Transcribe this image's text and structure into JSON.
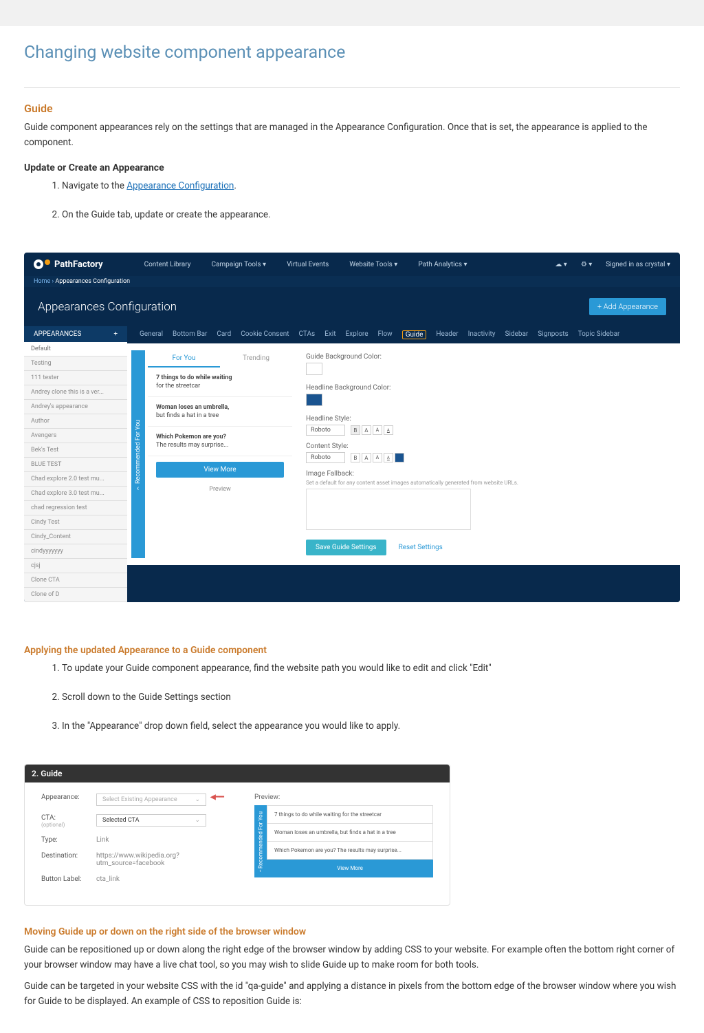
{
  "page_title": "Changing website component appearance",
  "guide_section": {
    "title": "Guide",
    "intro": "Guide component appearances rely on the settings that are managed in the Appearance Configuration. Once that is set, the appearance is applied to the component.",
    "update_heading": "Update or Create an Appearance",
    "step1_prefix": "Navigate to the ",
    "step1_link": "Appearance Configuration",
    "step1_suffix": ".",
    "step2": "On the Guide tab, update or create the appearance."
  },
  "shot1": {
    "logo": "PathFactory",
    "nav": [
      "Content Library",
      "Campaign Tools ▾",
      "Virtual Events",
      "Website Tools ▾",
      "Path Analytics ▾"
    ],
    "cloud_icon": "☁ ▾",
    "gear_icon": "⚙ ▾",
    "signed_in": "Signed in as crystal ▾",
    "breadcrumb_home": "Home",
    "breadcrumb_sep": " › ",
    "breadcrumb_page": "Appearances Configuration",
    "header": "Appearances Configuration",
    "btn_add": "+ Add Appearance",
    "sidebar_tab": "APPEARANCES",
    "sidebar_plus": "+",
    "sidebar_items": [
      "Default",
      "Testing",
      "111 tester",
      "Andrey clone this is a ver...",
      "Andrey's appearance",
      "Author",
      "Avengers",
      "Bek's Test",
      "BLUE TEST",
      "Chad explore 2.0 test mu...",
      "Chad explore 3.0 test mu...",
      "chad regression test",
      "Cindy Test",
      "Cindy_Content",
      "cindyyyyyyy",
      "cjsj",
      "Clone CTA",
      "Clone of D"
    ],
    "tabs": [
      "General",
      "Bottom Bar",
      "Card",
      "Cookie Consent",
      "CTAs",
      "Exit",
      "Explore",
      "Flow",
      "Guide",
      "Header",
      "Inactivity",
      "Sidebar",
      "Signposts",
      "Topic Sidebar"
    ],
    "active_tab": "Guide",
    "rec_side": "Recommended For You",
    "rec_tab1": "For You",
    "rec_tab2": "Trending",
    "rec_items": [
      {
        "title": "7 things to do while waiting",
        "sub": "for the streetcar"
      },
      {
        "title": "Woman loses an umbrella,",
        "sub": "but finds a hat in a tree"
      },
      {
        "title": "Which Pokemon are you?",
        "sub": "The results may surprise..."
      }
    ],
    "btn_viewmore": "View More",
    "btn_preview": "Preview",
    "labels": {
      "bg": "Guide Background Color:",
      "headline_bg": "Headline Background Color:",
      "headline_style": "Headline Style:",
      "content_style": "Content Style:",
      "fallback": "Image Fallback:",
      "fallback_hint": "Set a default for any content asset images automatically generated from website URLs."
    },
    "font": "Roboto",
    "btn_save": "Save Guide Settings",
    "btn_reset": "Reset Settings"
  },
  "applying": {
    "heading": "Applying the updated Appearance to a Guide component",
    "step1": "To update your Guide component appearance, find the website path you would like to edit and click \"Edit\"",
    "step2": "Scroll down to the Guide Settings section",
    "step3": "In the \"Appearance\" drop down field, select the appearance you would like to apply."
  },
  "shot2": {
    "header": "2. Guide",
    "rows": {
      "appearance": {
        "label": "Appearance:",
        "value": "Select Existing Appearance"
      },
      "cta": {
        "label": "CTA:",
        "opt": "(optional)",
        "value": "Selected CTA"
      },
      "type": {
        "label": "Type:",
        "value": "Link"
      },
      "dest": {
        "label": "Destination:",
        "value": "https://www.wikipedia.org?utm_source=facebook"
      },
      "btn_label": {
        "label": "Button Label:",
        "value": "cta_link"
      }
    },
    "preview_label": "Preview:",
    "preview_side": "Recommended For You",
    "preview_items": [
      "7 things to do while\nwaiting for the streetcar",
      "Woman loses an umbrella,\nbut finds a hat in a tree",
      "Which Pokemon are you?\nThe results may surprise..."
    ],
    "preview_viewmore": "View More"
  },
  "moving": {
    "heading": "Moving Guide up or down on the right side of the browser window",
    "p1": "Guide can be repositioned up or down along the right edge of the browser window by adding CSS to your website. For example often the bottom right corner of your browser window may have a live chat tool, so you may wish to slide Guide up to make room for both tools.",
    "p2": "Guide can be targeted in your website CSS with the id \"qa-guide\" and applying a distance in pixels from the bottom edge of the browser window where you wish for Guide to be displayed. An example of CSS to reposition Guide is:"
  }
}
